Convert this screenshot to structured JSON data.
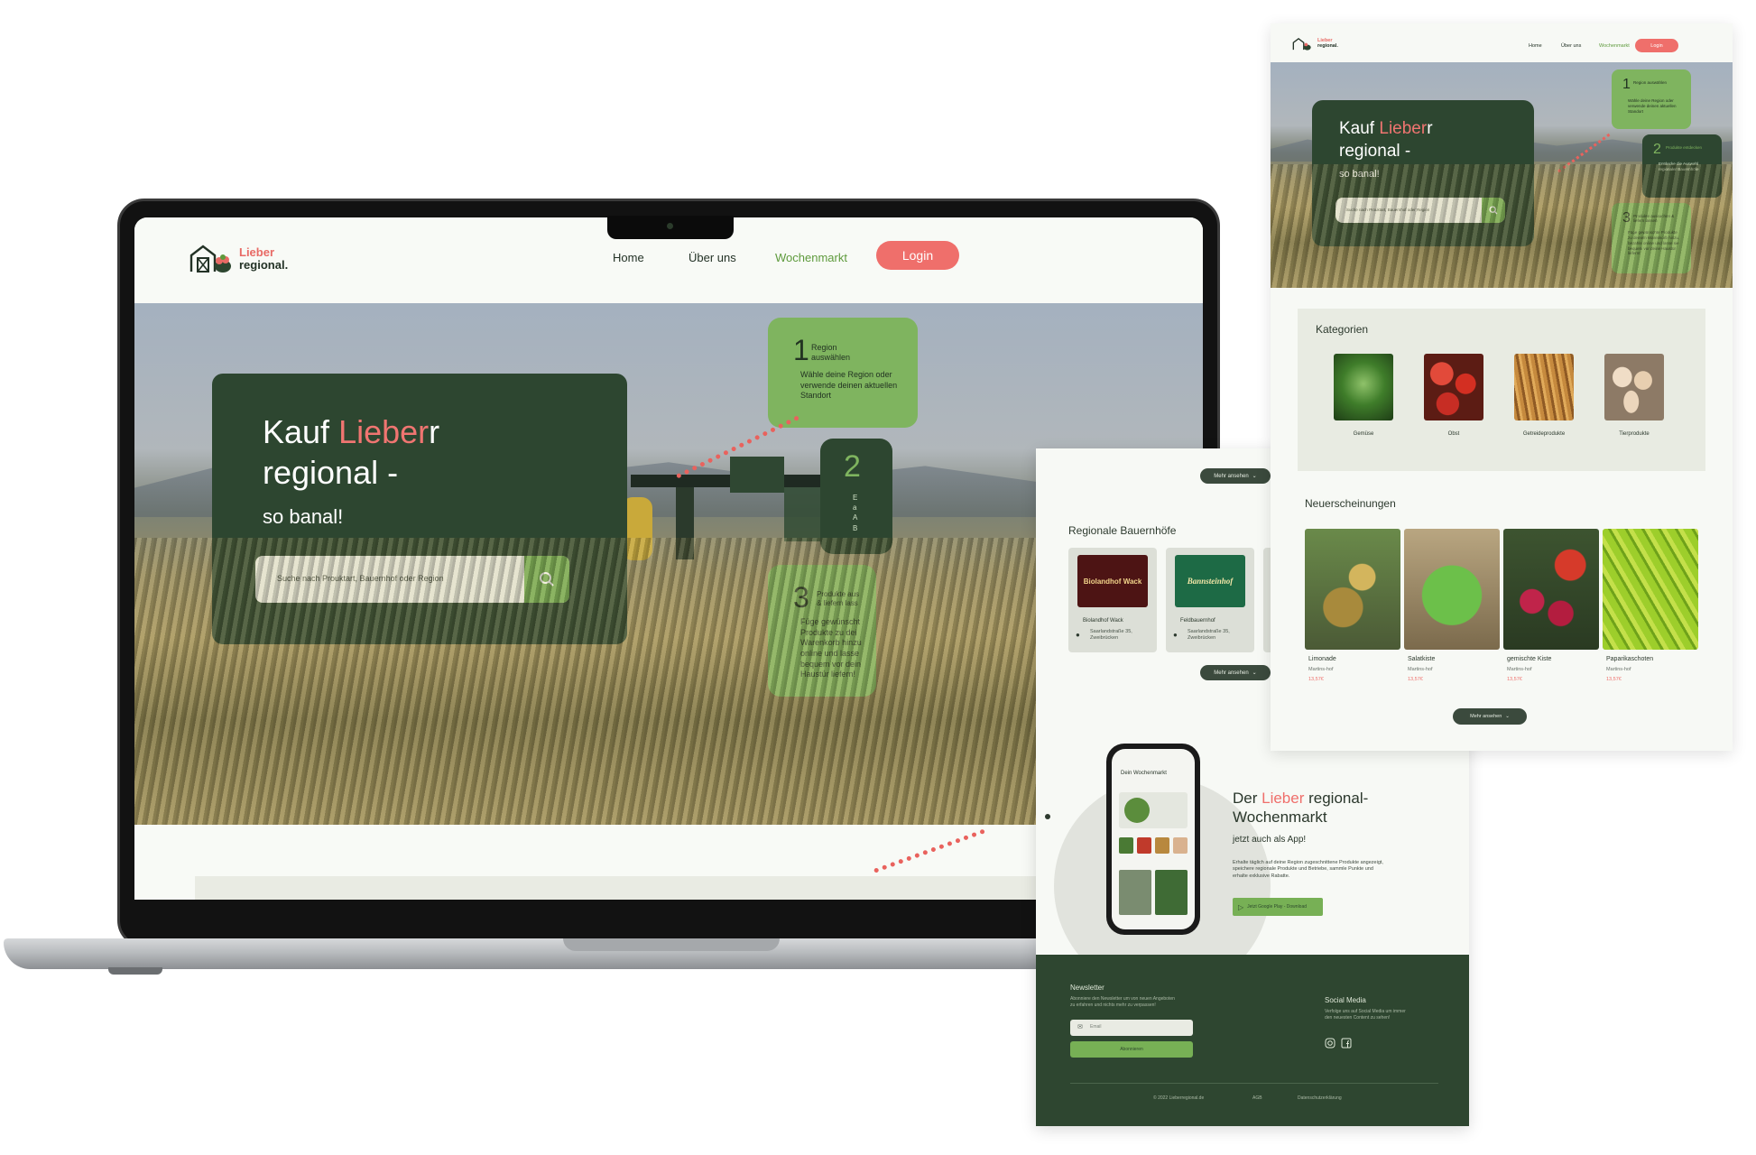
{
  "brand": {
    "logo_line1": "Lieber",
    "logo_line2": "regional."
  },
  "nav": {
    "home": "Home",
    "about": "Über uns",
    "market": "Wochenmarkt",
    "login": "Login"
  },
  "hero": {
    "title_pre": "Kauf ",
    "title_highlight": "Lieber",
    "title_post": "r",
    "title_line2": "regional -",
    "subtitle": "so banal!",
    "search_placeholder": "Suche nach Prouktart, Bauernhof oder Region"
  },
  "steps": [
    {
      "num": "1",
      "title": "Region auswählen",
      "desc": "Wähle deine Region oder verwende deinen aktuellen Standort"
    },
    {
      "num": "2",
      "title": "Produkte entdecken",
      "desc": "Entdecke die Auswahl regionaler Bauernhöfe"
    },
    {
      "num": "3",
      "title": "Produkte aussuchen & liefern lassen",
      "desc": "Füge gewünschte Produkte zu deinem Warenkorb hinzu, bezahle online und lasse sie bequem vor deine Haustür liefern!"
    }
  ],
  "steps_cut": {
    "step2_num": "2",
    "step2_lines": [
      "E",
      "a",
      "A",
      "B"
    ],
    "step3_title": "Produkte aus",
    "step3_title2": "& liefern lass",
    "step3_desc": [
      "Füge gewünscht",
      "Produkte zu dei",
      "Warenkorb hinzu",
      "online und lasse",
      "bequem vor dein",
      "Haustür liefern!"
    ]
  },
  "mid": {
    "more_button": "Mehr ansehen",
    "farms_title": "Regionale Bauernhöfe",
    "farms": [
      {
        "logo": "Biolandhof Wack",
        "name": "Biolandhof Wack",
        "address": "Saarlandstraße 35, Zweibrücken"
      },
      {
        "logo": "Bannsteinhof",
        "name": "Feldbauernhof",
        "address": "Saarlandstraße 35, Zweibrücken"
      }
    ],
    "app_title_pre": "Der ",
    "app_title_highlight": "Lieber",
    "app_title_post": " regional-",
    "app_title_line2": "Wochenmarkt",
    "app_subtitle": "jetzt auch als App!",
    "app_desc": "Erhalte täglich auf deine Region zugeschnittene Produkte angezeigt, speichere regionale Produkte und Betriebe, sammle Punkte und erhalte exklusive Rabatte.",
    "app_store_button": "Jetzt Google Play - Download",
    "phone_title": "Dein Wochenmarkt",
    "newsletter_title": "Newsletter",
    "newsletter_desc": "Abonniere den Newsletter um von neuen Angeboten zu erfahren und nichts mehr zu verpassen!",
    "email_placeholder": "Email",
    "subscribe_button": "Abonnieren",
    "social_title": "Social Media",
    "social_desc": "Verfolge uns auf Social Media um immer den neuesten Content zu sehen!",
    "footer_copyright": "© 2022 Lieberregional.de",
    "footer_agb": "AGB",
    "footer_privacy": "Datenschutzerklärung"
  },
  "right": {
    "hero_title_pre": "Kauf ",
    "hero_title_highlight": "Lieber",
    "hero_title_post": "r",
    "hero_title_line2": "regional -",
    "hero_subtitle": "so banal!",
    "search_placeholder": "Suche nach Prouktart, Bauernhof oder Region",
    "step1_title": "Region auswählen",
    "step1_desc": "Wähle deine Region oder verwende deinen aktuellen Standort",
    "step2_title": "Produkte entdecken",
    "step2_desc": "Entdecke die Auswahl regionaler Bauernhöfe",
    "step3_title": "Produkte aussuchen & liefern lassen",
    "step3_desc": "Füge gewünschte Produkte zu deinem Warenkorb hinzu, bezahle online und lasse sie bequem vor deine Haustür liefern!",
    "categories_title": "Kategorien",
    "categories": [
      "Gemüse",
      "Obst",
      "Getreideprodukte",
      "Tierprodukte"
    ],
    "new_title": "Neuerscheinungen",
    "products": [
      {
        "name": "Limonade",
        "farm": "Martins-hof",
        "price": "13,57€"
      },
      {
        "name": "Salatkiste",
        "farm": "Martins-hof",
        "price": "13,57€"
      },
      {
        "name": "gemischte Kiste",
        "farm": "Martins-hof",
        "price": "13,57€"
      },
      {
        "name": "Paparikaschoten",
        "farm": "Martins-hof",
        "price": "13,57€"
      }
    ],
    "more_button": "Mehr ansehen"
  },
  "colors": {
    "dark_green": "#2d4630",
    "light_green": "#7fb45f",
    "accent_red": "#ef6f6b",
    "bg": "#f8faf6"
  }
}
